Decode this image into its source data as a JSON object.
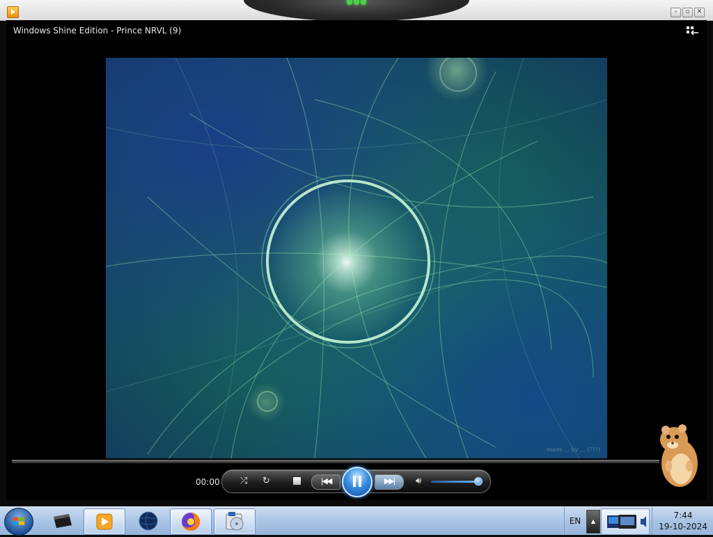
{
  "window": {
    "title_bar_buttons": [
      "minimize-icon",
      "restore-icon",
      "close-icon"
    ]
  },
  "player": {
    "now_playing": "Windows Shine Edition - Prince NRVL (9)",
    "time_elapsed": "00:00",
    "video_watermark": "made ... by ... (???)",
    "volume_level": 0.9,
    "seek_progress": 0.0,
    "state": "playing",
    "controls": [
      "shuffle-icon",
      "repeat-icon",
      "stop-icon",
      "previous-icon",
      "pause-icon",
      "next-icon",
      "volume-icon"
    ]
  },
  "taskbar": {
    "items": [
      {
        "name": "start-button",
        "icon": "windows-orb-icon"
      },
      {
        "name": "computer-icon",
        "active": false
      },
      {
        "name": "media-player-icon",
        "active": true
      },
      {
        "name": "globe-icon",
        "active": false
      },
      {
        "name": "firefox-icon",
        "active": true
      },
      {
        "name": "disk-utility-icon",
        "active": true
      }
    ],
    "language": "EN",
    "clock_time": "7:44",
    "clock_date": "19-10-2024"
  },
  "colors": {
    "accent_blue": "#3a8ee0",
    "taskbar": "#a9c4e4",
    "notch_green": "#4fd14a"
  }
}
